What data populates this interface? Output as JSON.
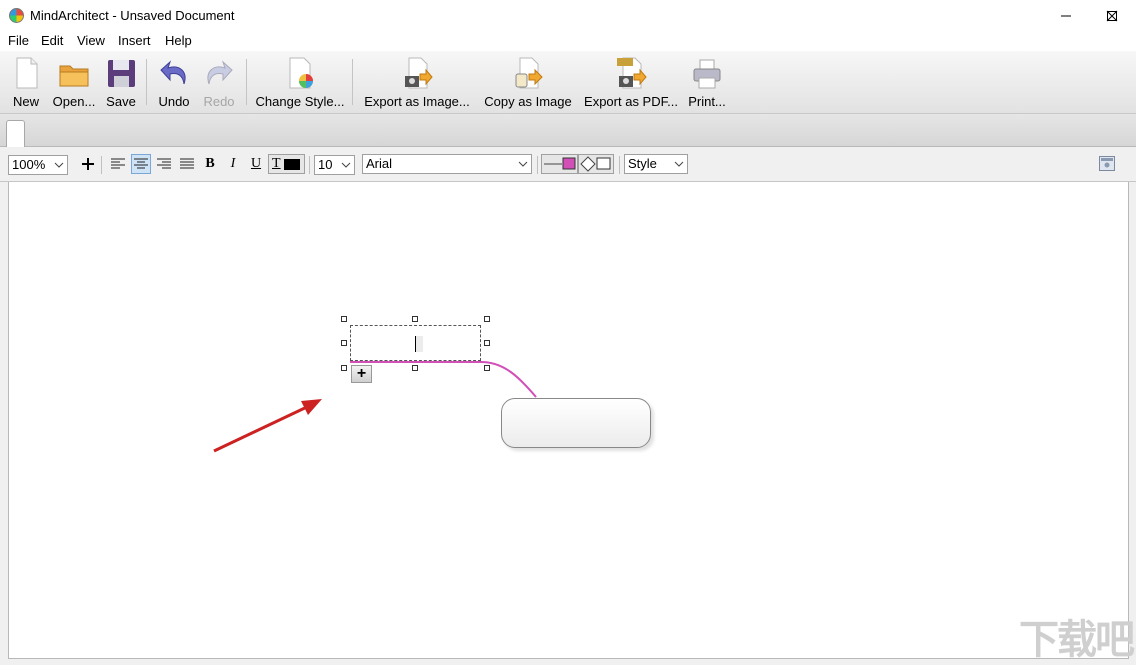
{
  "window": {
    "title": "MindArchitect - Unsaved Document",
    "controls": [
      "minimize",
      "maximize",
      "close"
    ]
  },
  "menu": {
    "items": [
      "File",
      "Edit",
      "View",
      "Insert",
      "Help"
    ]
  },
  "toolbar": {
    "buttons": [
      {
        "label": "New",
        "icon": "new-document-icon",
        "enabled": true
      },
      {
        "label": "Open...",
        "icon": "folder-icon",
        "enabled": true
      },
      {
        "label": "Save",
        "icon": "floppy-disk-icon",
        "enabled": true
      },
      {
        "label": "Undo",
        "icon": "undo-arrow-icon",
        "enabled": true
      },
      {
        "label": "Redo",
        "icon": "redo-arrow-icon",
        "enabled": false
      },
      {
        "label": "Change Style...",
        "icon": "style-palette-icon",
        "enabled": true
      },
      {
        "label": "Export as Image...",
        "icon": "export-image-icon",
        "enabled": true
      },
      {
        "label": "Copy as Image",
        "icon": "copy-image-icon",
        "enabled": true
      },
      {
        "label": "Export as PDF...",
        "icon": "export-pdf-icon",
        "enabled": true
      },
      {
        "label": "Print...",
        "icon": "printer-icon",
        "enabled": true
      }
    ]
  },
  "format_bar": {
    "zoom": "100%",
    "font_size": "10",
    "font_family": "Arial",
    "style_select": "Style",
    "bold_label": "B",
    "italic_label": "I",
    "underline_label": "U",
    "text_color_label": "T",
    "colors": {
      "text": "#000000",
      "line": "#d24fb8",
      "fill": "#ffffff"
    }
  },
  "canvas": {
    "watermark": "下载吧",
    "add_child_label": "+",
    "connector_color": "#d24fb8",
    "arrow_color": "#cc2222"
  }
}
